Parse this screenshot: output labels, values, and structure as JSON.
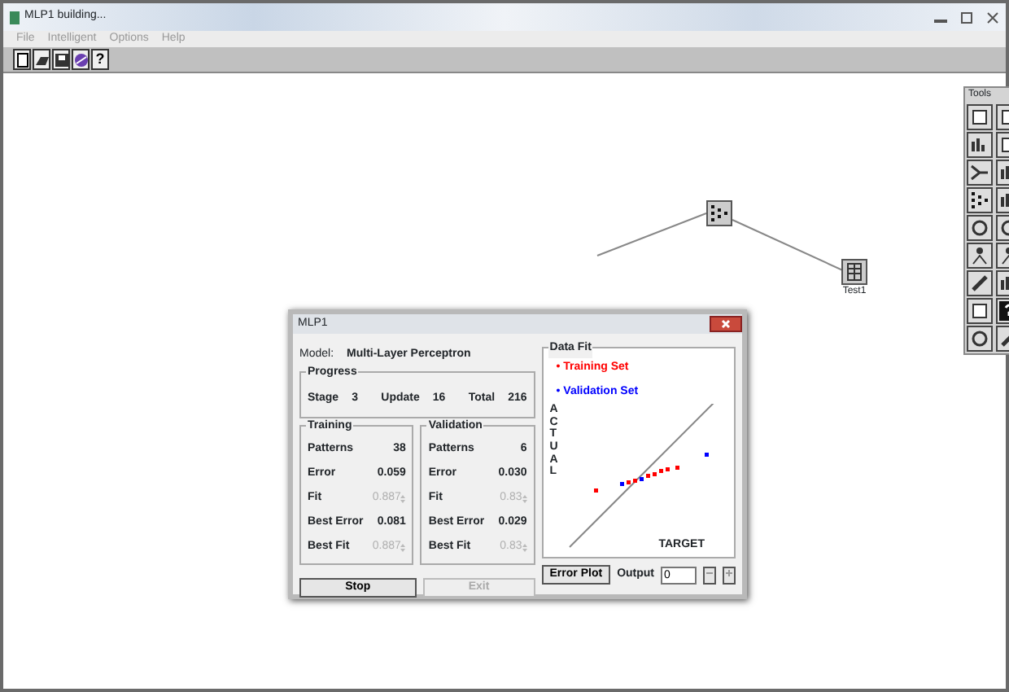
{
  "window": {
    "title": "MLP1 building..."
  },
  "menu": [
    {
      "label": "File"
    },
    {
      "label": "Intelligent"
    },
    {
      "label": "Options"
    },
    {
      "label": "Help"
    }
  ],
  "toolbar": [
    {
      "kind": "new"
    },
    {
      "kind": "open"
    },
    {
      "kind": "save"
    },
    {
      "kind": "wizard"
    },
    {
      "kind": "help",
      "label": "?"
    }
  ],
  "nodes": [
    {
      "kind": "network"
    },
    {
      "kind": "table",
      "label": "Test1"
    }
  ],
  "tools": {
    "title": "Tools",
    "items": [
      {
        "kind": "doc"
      },
      {
        "kind": "doc"
      },
      {
        "kind": "chart"
      },
      {
        "kind": "doc"
      },
      {
        "kind": "branch"
      },
      {
        "kind": "chart"
      },
      {
        "kind": "dots"
      },
      {
        "kind": "chart"
      },
      {
        "kind": "swirl"
      },
      {
        "kind": "swirl"
      },
      {
        "kind": "people"
      },
      {
        "kind": "people"
      },
      {
        "kind": "pen"
      },
      {
        "kind": "chart"
      },
      {
        "kind": "doc"
      },
      {
        "kind": "help"
      },
      {
        "kind": "swirl"
      },
      {
        "kind": "pen"
      }
    ]
  },
  "dialog": {
    "title": "MLP1",
    "model_label": "Model:",
    "model": "Multi-Layer Perceptron",
    "progress": {
      "title": "Progress",
      "items": [
        {
          "label": "Stage",
          "value": "3"
        },
        {
          "label": "Update",
          "value": "16"
        },
        {
          "label": "Total",
          "value": "216"
        }
      ]
    },
    "panels": [
      {
        "title": "Training",
        "rows": [
          {
            "label": "Patterns",
            "value": "38",
            "disabled": false
          },
          {
            "label": "Error",
            "value": "0.059",
            "disabled": false
          },
          {
            "label": "Fit",
            "value": "0.887",
            "disabled": true
          },
          {
            "label": "Best Error",
            "value": "0.081",
            "disabled": false
          },
          {
            "label": "Best Fit",
            "value": "0.887",
            "disabled": true
          }
        ]
      },
      {
        "title": "Validation",
        "rows": [
          {
            "label": "Patterns",
            "value": "6",
            "disabled": false
          },
          {
            "label": "Error",
            "value": "0.030",
            "disabled": false
          },
          {
            "label": "Fit",
            "value": "0.83",
            "disabled": true
          },
          {
            "label": "Best Error",
            "value": "0.029",
            "disabled": false
          },
          {
            "label": "Best Fit",
            "value": "0.83",
            "disabled": true
          }
        ]
      }
    ],
    "buttons": [
      {
        "label": "Stop",
        "disabled": false
      },
      {
        "label": "Exit",
        "disabled": true
      }
    ],
    "data_fit": {
      "title": "Data Fit",
      "legend": [
        {
          "label": "• Training Set",
          "color": "#ff0000"
        },
        {
          "label": "• Validation Set",
          "color": "#0000ff"
        }
      ],
      "ylabel": "ACTUAL",
      "xlabel": "TARGET"
    },
    "error_plot_button": "Error Plot",
    "output_label": "Output",
    "output_value": "0"
  }
}
